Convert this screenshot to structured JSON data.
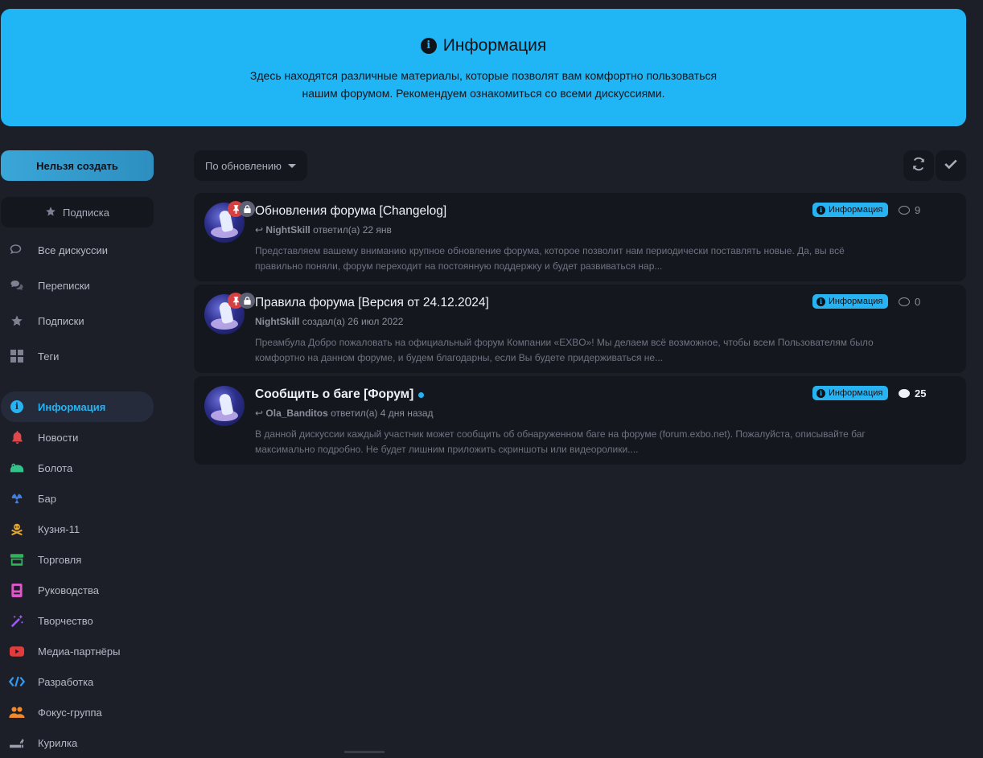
{
  "hero": {
    "title": "Информация",
    "description": "Здесь находятся различные материалы, которые позволят вам комфортно пользоваться нашим форумом. Рекомендуем ознакомиться со всеми дискуссиями.",
    "background": "#20b6f5"
  },
  "sidebar": {
    "create_label": "Нельзя создать",
    "subscribe_label": "Подписка",
    "primary": [
      {
        "label": "Все дискуссии",
        "icon": "chat-bubbles-icon"
      },
      {
        "label": "Переписки",
        "icon": "messages-icon"
      },
      {
        "label": "Подписки",
        "icon": "star-icon"
      },
      {
        "label": "Теги",
        "icon": "grid-icon"
      }
    ],
    "tags": [
      {
        "label": "Информация",
        "icon": "info-icon",
        "color": "#27b3f2",
        "active": true
      },
      {
        "label": "Новости",
        "icon": "bell-icon",
        "color": "#e0484c"
      },
      {
        "label": "Болота",
        "icon": "frog-icon",
        "color": "#33c28a"
      },
      {
        "label": "Бар",
        "icon": "radiation-icon",
        "color": "#3f7fe0"
      },
      {
        "label": "Кузня-11",
        "icon": "skull-crossbones-icon",
        "color": "#e3a72f"
      },
      {
        "label": "Торговля",
        "icon": "store-icon",
        "color": "#2fb45a"
      },
      {
        "label": "Руководства",
        "icon": "book-icon",
        "color": "#e056c8"
      },
      {
        "label": "Творчество",
        "icon": "magic-wand-icon",
        "color": "#9a5cf0"
      },
      {
        "label": "Медиа-партнёры",
        "icon": "youtube-icon",
        "color": "#e23b3b"
      },
      {
        "label": "Разработка",
        "icon": "code-icon",
        "color": "#2f9af0"
      },
      {
        "label": "Фокус-группа",
        "icon": "users-icon",
        "color": "#f08a2a"
      },
      {
        "label": "Курилка",
        "icon": "smoking-icon",
        "color": "#9aa0ad"
      }
    ]
  },
  "toolbar": {
    "sort_label": "По обновлению",
    "refresh_icon": "refresh-icon",
    "mark_read_icon": "check-icon"
  },
  "discussions": [
    {
      "title": "Обновления форума [Changelog]",
      "user": "NightSkill",
      "action": "ответил(а) 22 янв",
      "excerpt": "Представляем вашему вниманию крупное обновление форума, которое позволит нам периодически поставлять новые. Да, вы всё правильно поняли, форум переходит на постоянную поддержку и будет развиваться нар...",
      "tag": "Информация",
      "replies": "9",
      "pinned": true,
      "locked": true,
      "unread": false
    },
    {
      "title": "Правила форума [Версия от 24.12.2024]",
      "user": "NightSkill",
      "action": "создал(а) 26 июл 2022",
      "excerpt": "Преамбула Добро пожаловать на официальный форум Компании «EXBO»! Мы делаем всё возможное, чтобы всем Пользователям было комфортно на данном форуме, и будем благодарны, если Вы будете придерживаться не...",
      "tag": "Информация",
      "replies": "0",
      "pinned": true,
      "locked": true,
      "unread": false
    },
    {
      "title": "Сообщить о баге [Форум]",
      "user": "Ola_Banditos",
      "action": "ответил(а) 4 дня назад",
      "excerpt": "В данной дискуссии каждый участник может сообщить об обнаруженном баге на форуме (forum.exbo.net). Пожалуйста, описывайте баг максимально подробно. Не будет лишним приложить скриншоты или видеоролики....",
      "tag": "Информация",
      "replies": "25",
      "pinned": false,
      "locked": false,
      "unread": true
    }
  ]
}
